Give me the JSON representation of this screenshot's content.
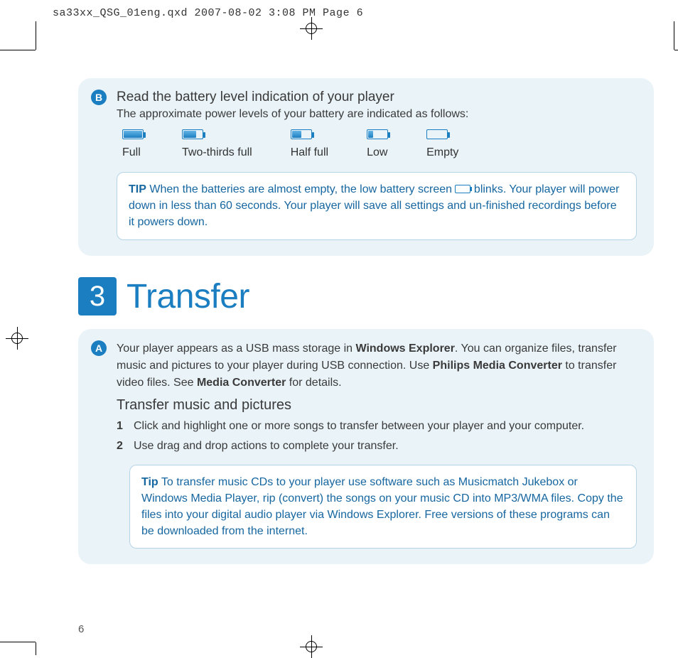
{
  "meta_header": "sa33xx_QSG_01eng.qxd  2007-08-02  3:08 PM  Page 6",
  "page_number": "6",
  "panelB": {
    "marker": "B",
    "title": "Read the battery level indication of your player",
    "subtitle": "The approximate power levels of your battery are indicated as follows:",
    "levels": [
      "Full",
      "Two-thirds full",
      "Half full",
      "Low",
      "Empty"
    ],
    "tip_label": "TIP",
    "tip_text_before": " When the batteries are almost empty, the low battery screen ",
    "tip_text_after": " blinks. Your player will power down in less than 60 seconds. Your player will save all settings and un-finished recordings before it powers down."
  },
  "section3": {
    "number": "3",
    "title": "Transfer"
  },
  "panelA": {
    "marker": "A",
    "intro_1": "Your player appears as a USB mass storage in ",
    "intro_bold_1": "Windows Explorer",
    "intro_2": ". You can organize files, transfer music and pictures to your player during USB connection. Use ",
    "intro_bold_2": "Philips Media Converter",
    "intro_3": " to transfer video files. See ",
    "intro_bold_3": "Media Converter",
    "intro_4": " for details.",
    "subheading": "Transfer music and pictures",
    "step1_n": "1",
    "step1": "Click and highlight one or more songs to transfer between your player and your computer.",
    "step2_n": "2",
    "step2": "Use drag and drop actions to complete your transfer.",
    "tip_label": "Tip",
    "tip_text": " To transfer music CDs to your player use software such as Musicmatch Jukebox or Windows Media Player, rip (convert) the songs on your music CD into MP3/WMA files. Copy the files into your digital audio player via Windows Explorer. Free versions of these programs can be downloaded from the internet."
  }
}
